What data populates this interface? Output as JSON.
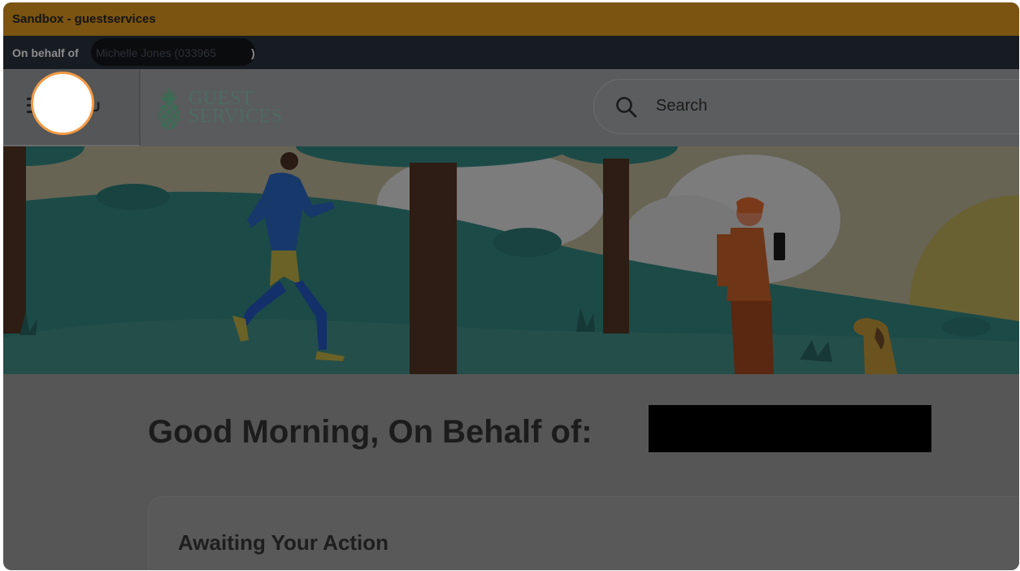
{
  "sandbox": {
    "label": "Sandbox - guestservices"
  },
  "proxy": {
    "prefix": "On behalf of",
    "name": "Michelle Jones (033965",
    "suffix": ")"
  },
  "header": {
    "menu_label": "MENU",
    "menu_label_visible": "U",
    "logo_line1": "GUEST",
    "logo_line2": "SERVICES",
    "search_placeholder": "Search"
  },
  "hero": {
    "illustration": "park-scene"
  },
  "main": {
    "greeting": "Good Morning, On Behalf of:",
    "awaiting_title": "Awaiting Your Action"
  },
  "colors": {
    "sandbox_bar": "#7a5410",
    "proxy_bar": "#171c22",
    "focus_ring": "#f39a45",
    "logo": "#4d6b61"
  },
  "icons": {
    "menu": "hamburger-icon",
    "logo": "pineapple-logo-icon",
    "search": "search-icon"
  }
}
